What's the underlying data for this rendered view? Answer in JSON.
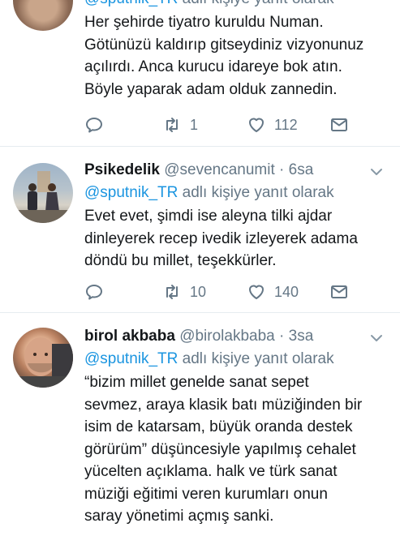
{
  "tweets": [
    {
      "display_name": "",
      "handle": "",
      "time": "",
      "reply_prefix": "@sputnik_TR",
      "reply_suffix": " adlı kişiye yanıt olarak",
      "lines": [
        "Her şehirde tiyatro kuruldu Numan.",
        "Götünüzü kaldırıp gitseydiniz vizyonunuz",
        "açılırdı. Anca kurucu idareye bok atın.",
        "Böyle yaparak adam olduk zannedin."
      ],
      "retweets": "1",
      "likes": "112"
    },
    {
      "display_name": "Psikedelik",
      "handle": "@sevencanumit",
      "dot": "·",
      "time": "6sa",
      "reply_prefix": "@sputnik_TR",
      "reply_suffix": " adlı kişiye yanıt olarak",
      "lines": [
        "Evet evet, şimdi ise aleyna tilki ajdar",
        "dinleyerek recep ivedik izleyerek adama",
        "döndü bu millet, teşekkürler."
      ],
      "retweets": "10",
      "likes": "140"
    },
    {
      "display_name": "birol akbaba",
      "handle": "@birolakbaba",
      "dot": "·",
      "time": "3sa",
      "reply_prefix": "@sputnik_TR",
      "reply_suffix": " adlı kişiye yanıt olarak",
      "lines": [
        "“bizim millet genelde sanat sepet",
        "sevmez, araya klasik batı müziğinden bir",
        "isim de katarsam, büyük oranda destek",
        "görürüm” düşüncesiyle yapılmış cehalet",
        "yücelten açıklama. halk ve türk sanat",
        "müziği eğitimi veren kurumları onun",
        "saray yönetimi açmış sanki."
      ]
    }
  ],
  "colors": {
    "accent": "#1b95e0",
    "muted": "#657786",
    "text": "#14171a",
    "divider": "#e6ecf0"
  }
}
